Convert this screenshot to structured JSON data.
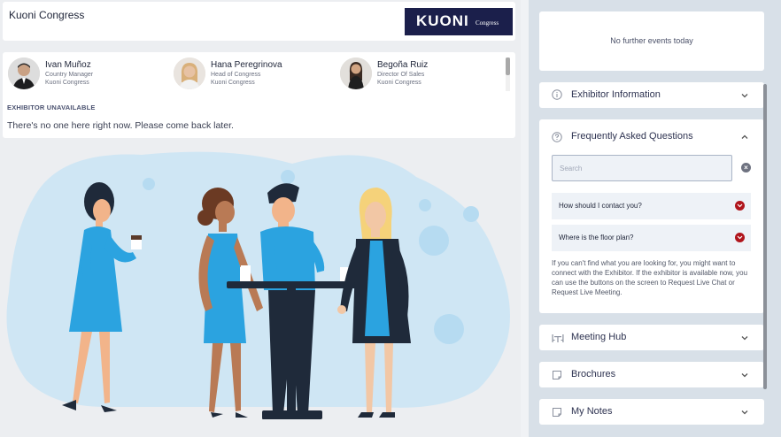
{
  "header": {
    "title": "Kuoni Congress",
    "logo_main": "KUONI",
    "logo_sub": "Congress"
  },
  "staff": [
    {
      "name": "Ivan Muñoz",
      "role": "Country Manager",
      "org": "Kuoni Congress"
    },
    {
      "name": "Hana Peregrinova",
      "role": "Head of Congress",
      "org": "Kuoni Congress"
    },
    {
      "name": "Begoña Ruiz",
      "role": "Director Of Sales",
      "org": "Kuoni Congress"
    }
  ],
  "status": {
    "label": "EXHIBITOR UNAVAILABLE",
    "message": "There's no one here right now. Please come back later."
  },
  "events": {
    "message": "No further events today"
  },
  "panels": {
    "exhibitor_info": "Exhibitor Information",
    "faq": "Frequently Asked Questions",
    "meeting_hub": "Meeting Hub",
    "brochures": "Brochures",
    "notes": "My Notes"
  },
  "faq": {
    "search_placeholder": "Search",
    "questions": [
      "How should I contact you?",
      "Where is the floor plan?"
    ],
    "help_text": "If you can't find what you are looking for, you might want to connect with the Exhibitor. If the exhibitor is available now, you can use the buttons on the screen to Request Live Chat or Request Live Meeting."
  },
  "colors": {
    "accent": "#b0151c",
    "brand": "#1b1f4b",
    "illustration_bg": "#cfe6f4",
    "shirt_blue": "#2ba3e0"
  }
}
